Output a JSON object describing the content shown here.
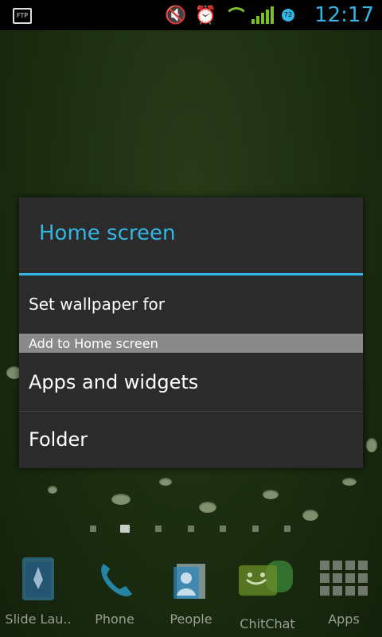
{
  "status_bar": {
    "time": "12:17",
    "left_icon": "ftp-icon",
    "ftp_text": "FTP",
    "badge_text": "72",
    "icons": [
      "mute-icon",
      "alarm-icon",
      "wifi-icon",
      "signal-icon",
      "data-badge-icon"
    ]
  },
  "dialog": {
    "title": "Home screen",
    "items": [
      {
        "label": "Set wallpaper for"
      }
    ],
    "section_header": "Add to Home screen",
    "section_items": [
      {
        "label": "Apps and widgets"
      },
      {
        "label": "Folder"
      }
    ]
  },
  "page_indicator": {
    "count": 7,
    "active_index": 1
  },
  "dock": {
    "apps": [
      {
        "label": "Slide Lau..",
        "icon": "rocket-launcher-icon"
      },
      {
        "label": "Phone",
        "icon": "phone-icon"
      },
      {
        "label": "People",
        "icon": "people-icon"
      },
      {
        "label": "ChitChat",
        "icon": "chat-icon"
      },
      {
        "label": "Apps",
        "icon": "apps-grid-icon"
      }
    ]
  },
  "colors": {
    "accent": "#33b5e5",
    "dialog_bg": "#2b2b2b",
    "section_bg": "#8a8a8a"
  }
}
